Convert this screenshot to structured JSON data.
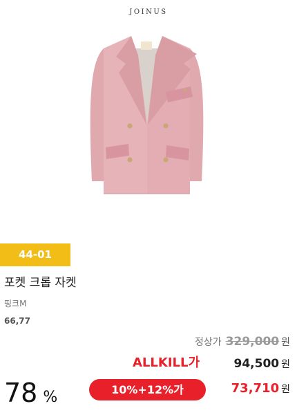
{
  "brand": {
    "logo_text": "JOINUS"
  },
  "product": {
    "code": "44-01",
    "name": "포켓 크롭 자켓",
    "color": "핑크M",
    "sizes": "66,77",
    "color_swatch": "#e6b3b8"
  },
  "pricing": {
    "regular_label": "정상가",
    "regular_price": "329,000",
    "won": "원",
    "allkill_logo": "ALLKILL가",
    "allkill_price": "94,500",
    "discount_rate": "78",
    "discount_unit": "%",
    "coupon_text": "10%+12%가",
    "final_price": "73,710"
  },
  "colors": {
    "badge": "#f3bd18",
    "accent_red": "#e8202a"
  }
}
